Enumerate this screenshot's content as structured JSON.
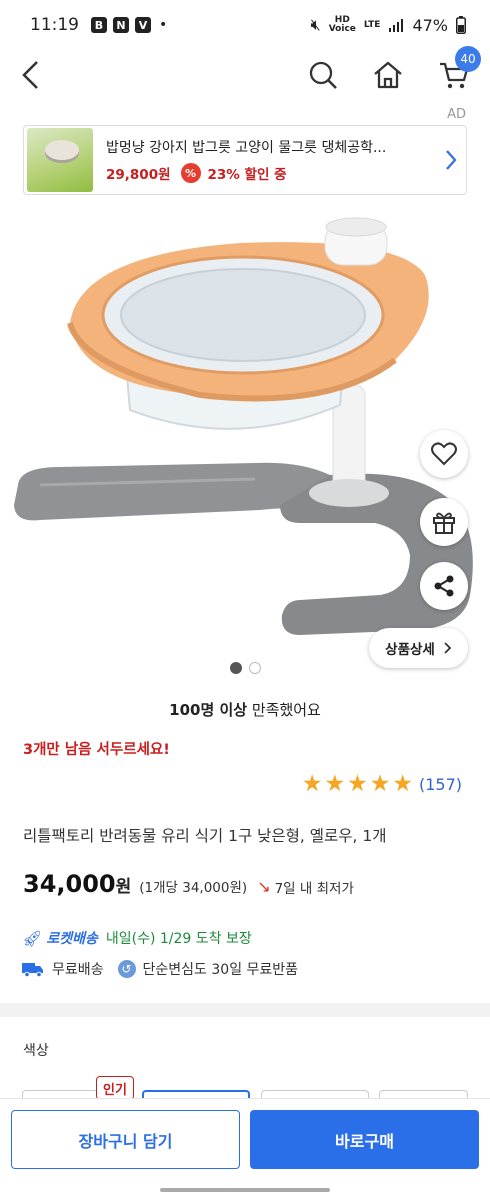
{
  "status_bar": {
    "time": "11:19",
    "app_icons": [
      "B",
      "N",
      "V"
    ],
    "battery": "47%",
    "hd_label": "HD\nVoice",
    "lte_label": "LTE"
  },
  "header": {
    "cart_count": "40"
  },
  "ad": {
    "label": "AD",
    "title": "밥멍냥 강아지 밥그릇 고양이 물그릇 댕체공학...",
    "price": "29,800원",
    "discount_icon": "%",
    "discount": "23% 할인 중"
  },
  "gallery": {
    "detail_button": "상품상세"
  },
  "satisfaction": {
    "bold": "100명 이상",
    "rest": " 만족했어요"
  },
  "stock_notice": "3개만 남음 서두르세요!",
  "rating": {
    "stars": 5,
    "count": "(157)"
  },
  "product": {
    "title": "리틀팩토리 반려동물 유리 식기 1구 낮은형, 옐로우, 1개",
    "price": "34,000",
    "won": "원",
    "unit_price": "(1개당 34,000원)",
    "lowest_label": "7일 내 최저가"
  },
  "delivery": {
    "rocket_label": "로켓배송",
    "arrival": "내일(수) 1/29 도착 보장",
    "free_shipping": "무료배송",
    "free_return": "단순변심도 30일 무료반품"
  },
  "options": {
    "color_label": "색상",
    "popular_badge": "인기"
  },
  "bottom": {
    "cart_button": "장바구니 담기",
    "buy_button": "바로구매"
  },
  "colors": {
    "accent": "#2a6fe8",
    "sale_red": "#c81e1e",
    "star": "#f5a623",
    "product_orange": "#f2b27a",
    "product_gray": "#8e9093"
  }
}
